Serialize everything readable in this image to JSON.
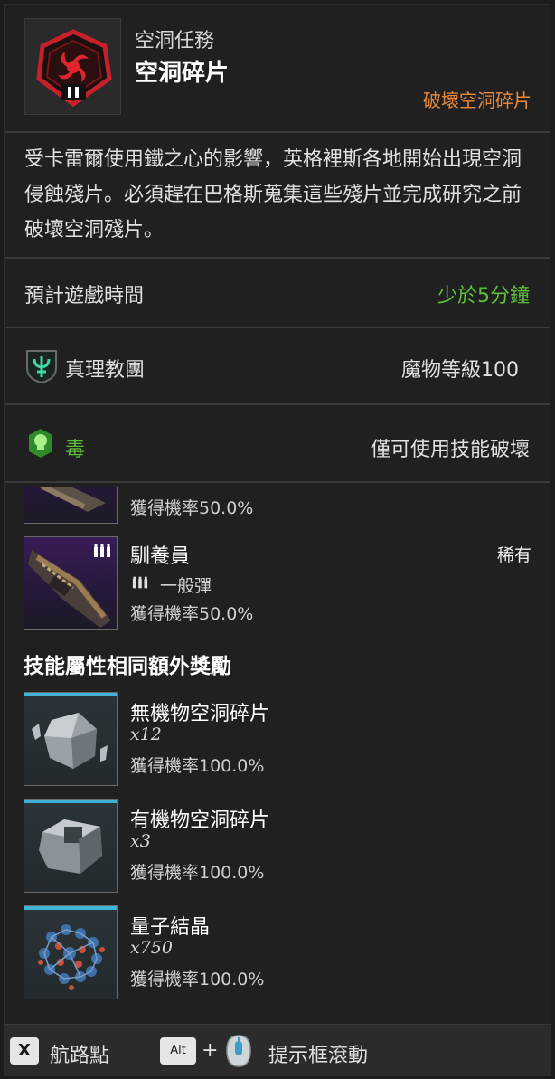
{
  "header": {
    "subtitle": "空洞任務",
    "title": "空洞碎片",
    "objective": "破壞空洞碎片",
    "emblem_icon": "void-shard-emblem-icon"
  },
  "description": "受卡雷爾使用鐵之心的影響，英格裡斯各地開始出現空洞侵蝕殘片。必須趕在巴格斯蒐集這些殘片並完成研究之前破壞空洞殘片。",
  "playtime": {
    "label": "預計遊戲時間",
    "value": "少於5分鐘",
    "value_color": "#5fbf3a"
  },
  "faction": {
    "icon": "cult-of-truth-icon",
    "label": "真理教團",
    "level": "魔物等級100"
  },
  "attribute": {
    "icon": "poison-icon",
    "label": "毒",
    "label_color": "#5fbf3a",
    "note": "僅可使用技能破壞"
  },
  "rewards": [
    {
      "chance": "獲得機率50.0%",
      "partial": true
    },
    {
      "name": "馴養員",
      "ammo": "一般彈",
      "chance": "獲得機率50.0%",
      "rarity": "稀有",
      "ammo_icon": "ammo-icon"
    }
  ],
  "bonus_section": {
    "title": "技能屬性相同額外獎勵",
    "items": [
      {
        "name": "無機物空洞碎片",
        "qty": "x12",
        "chance": "獲得機率100.0%",
        "icon": "inorganic-shard-icon"
      },
      {
        "name": "有機物空洞碎片",
        "qty": "x3",
        "chance": "獲得機率100.0%",
        "icon": "organic-shard-icon"
      },
      {
        "name": "量子結晶",
        "qty": "x750",
        "chance": "獲得機率100.0%",
        "icon": "quantum-crystal-icon"
      }
    ]
  },
  "footer": {
    "waypoint_key": "X",
    "waypoint_label": "航路點",
    "alt_key": "Alt",
    "plus": "+",
    "scroll_icon": "mouse-wheel-icon",
    "scroll_label": "提示框滾動"
  }
}
